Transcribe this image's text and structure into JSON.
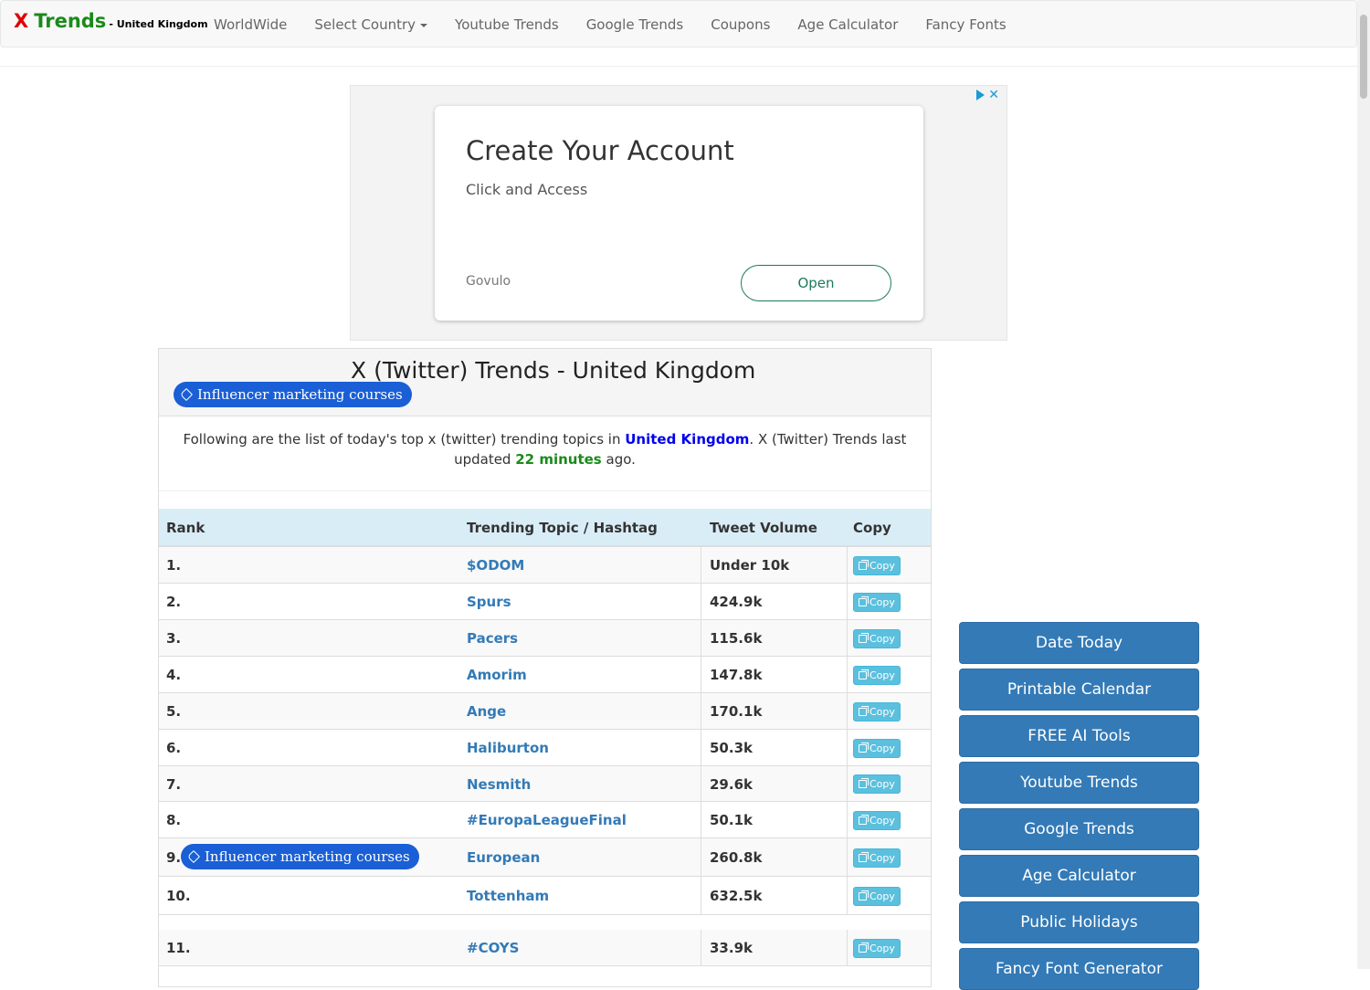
{
  "brand": {
    "x": "X",
    "trends": "Trends",
    "country": "- United Kingdom"
  },
  "nav": [
    "WorldWide",
    "Select Country",
    "Youtube Trends",
    "Google Trends",
    "Coupons",
    "Age Calculator",
    "Fancy Fonts"
  ],
  "ad": {
    "title": "Create Your Account",
    "subtitle": "Click and Access",
    "advertiser": "Govulo",
    "button": "Open",
    "close": "✕"
  },
  "panel": {
    "title": "X (Twitter) Trends - United Kingdom",
    "pill": "Influencer marketing courses",
    "intro_pre": "Following are the list of today's top x (twitter) trending topics in ",
    "intro_country": "United Kingdom",
    "intro_mid": ". X (Twitter) Trends last updated ",
    "intro_minutes": "22 minutes",
    "intro_post": " ago."
  },
  "table": {
    "headers": {
      "rank": "Rank",
      "topic": "Trending Topic / Hashtag",
      "volume": "Tweet Volume",
      "copy": "Copy"
    },
    "copy_label": "Copy",
    "rows": [
      {
        "rank": "1.",
        "topic": "$ODOM",
        "volume": "Under 10k"
      },
      {
        "rank": "2.",
        "topic": "Spurs",
        "volume": "424.9k"
      },
      {
        "rank": "3.",
        "topic": "Pacers",
        "volume": "115.6k"
      },
      {
        "rank": "4.",
        "topic": "Amorim",
        "volume": "147.8k"
      },
      {
        "rank": "5.",
        "topic": "Ange",
        "volume": "170.1k"
      },
      {
        "rank": "6.",
        "topic": "Haliburton",
        "volume": "50.3k"
      },
      {
        "rank": "7.",
        "topic": "Nesmith",
        "volume": "29.6k"
      },
      {
        "rank": "8.",
        "topic": "#EuropaLeagueFinal",
        "volume": "50.1k"
      },
      {
        "rank": "9.",
        "topic": "European",
        "volume": "260.8k",
        "pill": "Influencer marketing courses"
      },
      {
        "rank": "10.",
        "topic": "Tottenham",
        "volume": "632.5k"
      },
      {
        "rank": "11.",
        "topic": "#COYS",
        "volume": "33.9k"
      }
    ]
  },
  "sidebar": [
    "Date Today",
    "Printable Calendar",
    "FREE AI Tools",
    "Youtube Trends",
    "Google Trends",
    "Age Calculator",
    "Public Holidays",
    "Fancy Font Generator"
  ]
}
